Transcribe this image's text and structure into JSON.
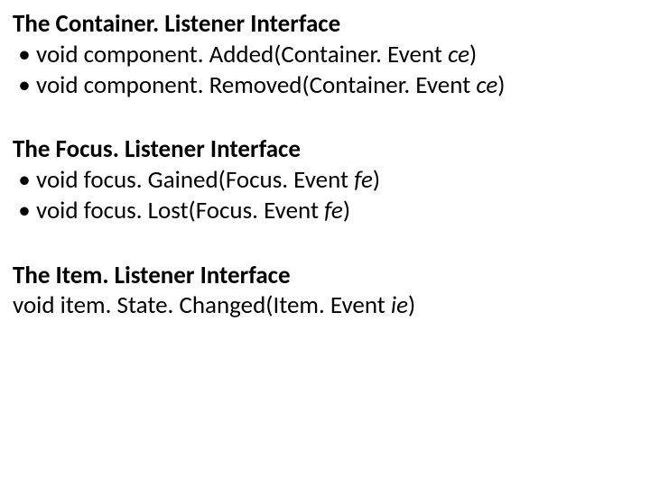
{
  "sections": [
    {
      "heading": "The Container. Listener Interface",
      "items": [
        {
          "pre": "void component. Added(Container. Event ",
          "param": "ce",
          "post": ")"
        },
        {
          "pre": "void component. Removed(Container. Event ",
          "param": "ce",
          "post": ")"
        }
      ]
    },
    {
      "heading": "The Focus. Listener Interface",
      "items": [
        {
          "pre": "void focus. Gained(Focus. Event ",
          "param": "fe",
          "post": ")"
        },
        {
          "pre": "void focus. Lost(Focus. Event ",
          "param": "fe",
          "post": ")"
        }
      ]
    },
    {
      "heading": "The Item. Listener Interface",
      "plain": [
        {
          "pre": "void item. State. Changed(Item. Event ",
          "param": "ie",
          "post": ")"
        }
      ]
    }
  ],
  "bullet": "•"
}
